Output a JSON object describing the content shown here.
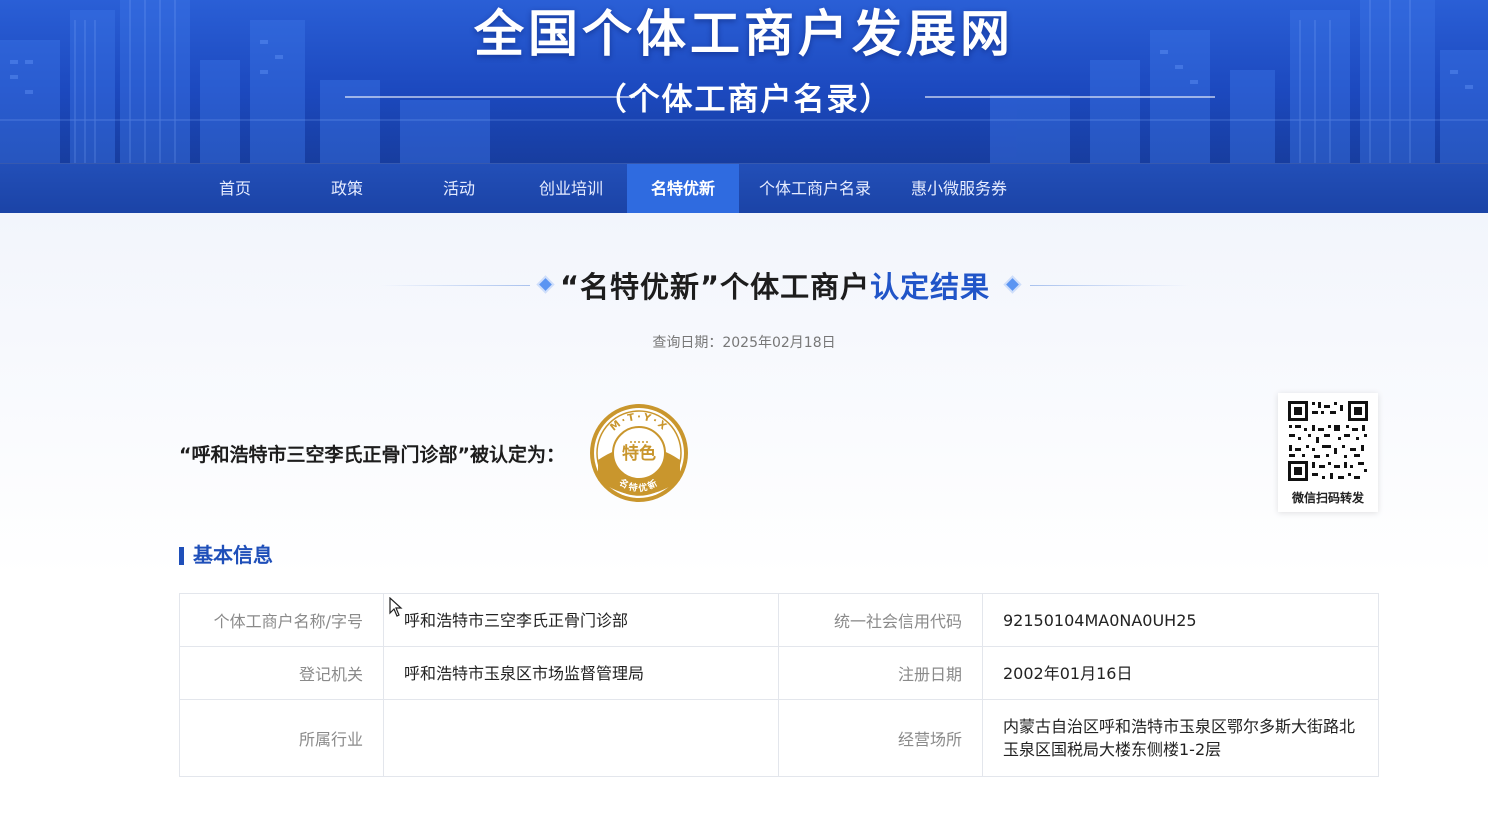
{
  "header": {
    "site_title": "全国个体工商户发展网",
    "site_subtitle": "（个体工商户名录）"
  },
  "nav": {
    "items": [
      {
        "label": "首页"
      },
      {
        "label": "政策"
      },
      {
        "label": "活动"
      },
      {
        "label": "创业培训"
      },
      {
        "label": "名特优新",
        "active": true
      },
      {
        "label": "个体工商户名录"
      },
      {
        "label": "惠小微服务券"
      }
    ]
  },
  "result": {
    "title_main": "“名特优新”个体工商户",
    "title_highlight": "认定结果",
    "query_date": "查询日期：2025年02月18日",
    "recognized_text": "“呼和浩特市三空李氏正骨门诊部”被认定为：",
    "badge": {
      "top_letters": "M·T·Y·X",
      "center_text": "特色",
      "bottom_text": "名特优新",
      "color": "#c9962d"
    },
    "qr_caption": "微信扫码转发"
  },
  "basic_info": {
    "section_title": "基本信息",
    "rows": [
      {
        "k1": "个体工商户名称/字号",
        "v1": "呼和浩特市三空李氏正骨门诊部",
        "k2": "统一社会信用代码",
        "v2": "92150104MA0NA0UH25"
      },
      {
        "k1": "登记机关",
        "v1": "呼和浩特市玉泉区市场监督管理局",
        "k2": "注册日期",
        "v2": "2002年01月16日"
      },
      {
        "k1": "所属行业",
        "v1": "",
        "k2": "经营场所",
        "v2": "内蒙古自治区呼和浩特市玉泉区鄂尔多斯大街路北玉泉区国税局大楼东侧楼1-2层"
      }
    ]
  },
  "colors": {
    "brand_blue": "#1f4fb9",
    "nav_active": "#2f6be0",
    "badge_gold": "#c9962d"
  }
}
